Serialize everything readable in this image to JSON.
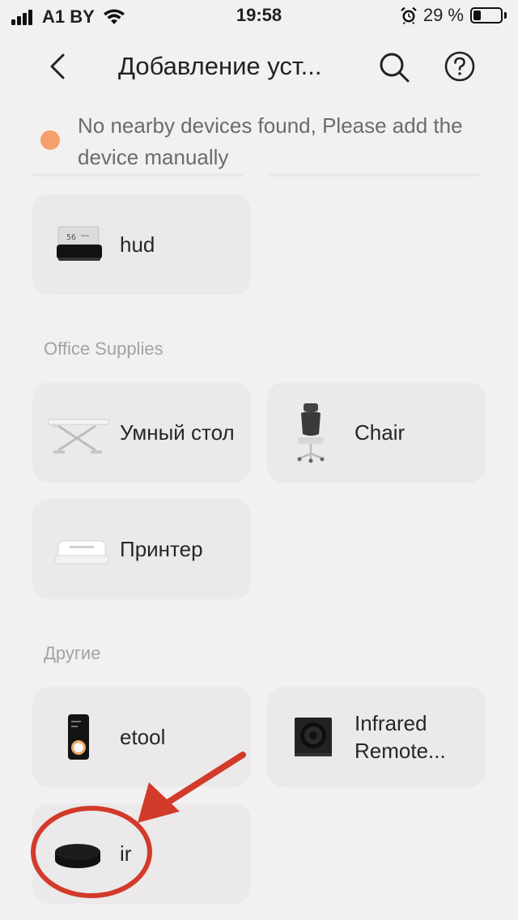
{
  "status_bar": {
    "carrier": "A1 BY",
    "time": "19:58",
    "battery_percent": "29 %",
    "battery_level": 0.29
  },
  "header": {
    "title": "Добавление уст..."
  },
  "notice": {
    "text": "No nearby devices found, Please add the device manually",
    "dot_color": "#f5a06a"
  },
  "sections": [
    {
      "label": "",
      "devices": [
        {
          "label": "hud",
          "icon": "hud-device-icon"
        }
      ]
    },
    {
      "label": "Office Supplies",
      "devices": [
        {
          "label": "Умный стол",
          "icon": "standing-desk-icon"
        },
        {
          "label": "Chair",
          "icon": "office-chair-icon"
        },
        {
          "label": "Принтер",
          "icon": "printer-icon"
        }
      ]
    },
    {
      "label": "Другие",
      "devices": [
        {
          "label": "etool",
          "icon": "etool-device-icon"
        },
        {
          "label": "Infrared Remote...",
          "icon": "infrared-remote-icon"
        },
        {
          "label": "ir",
          "icon": "ir-puck-icon"
        }
      ]
    }
  ],
  "annotation": {
    "color": "#d23a2a"
  }
}
